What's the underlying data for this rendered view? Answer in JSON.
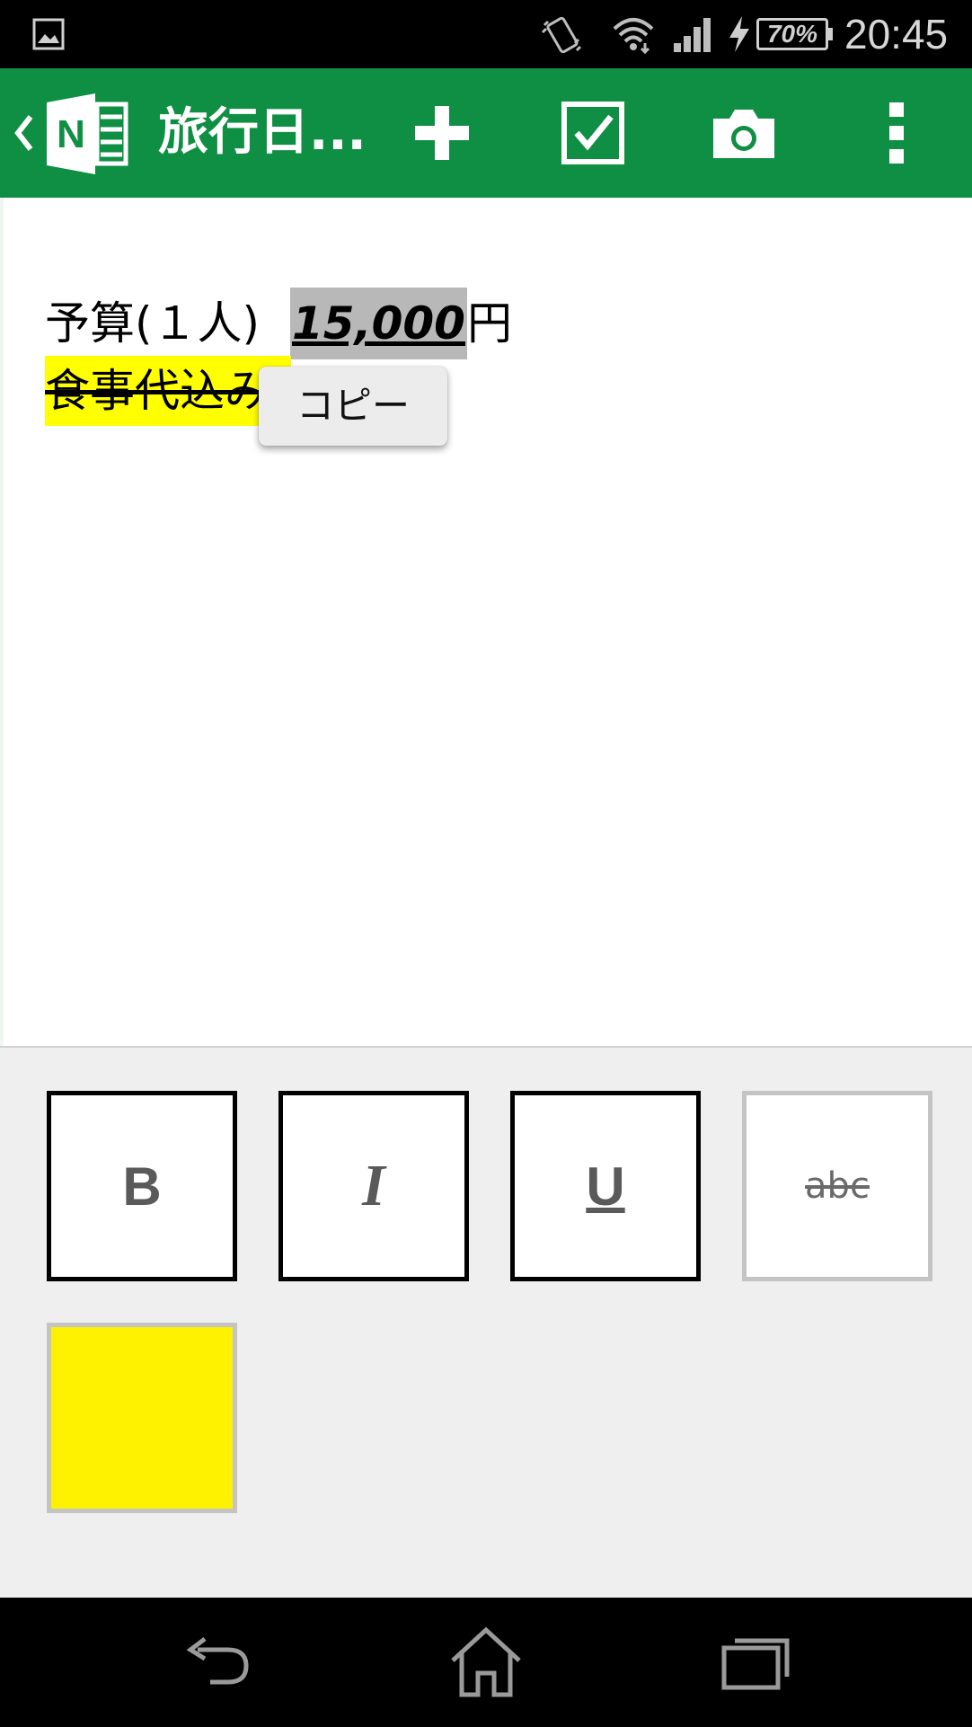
{
  "status_bar": {
    "battery": "70%",
    "time": "20:45",
    "icons": [
      "gallery-icon",
      "vibrate-icon",
      "wifi-icon",
      "signal-icon",
      "charging-icon",
      "battery-icon"
    ]
  },
  "app_bar": {
    "title": "旅行日...",
    "color": "#0f8f43",
    "icons": [
      "up-chevron-icon",
      "onenote-logo",
      "add-icon",
      "checkbox-icon",
      "camera-icon",
      "more-vert-icon"
    ]
  },
  "note": {
    "budget_label": "予算(１人)",
    "budget_value": "15,000",
    "budget_unit": "円",
    "meal_text": "食事代込み",
    "highlight_color": "#ffff00",
    "selection_color": "#b8b8b8"
  },
  "context_menu": {
    "copy_label": "コピー"
  },
  "format_panel": {
    "bold_label": "B",
    "italic_label": "I",
    "underline_label": "U",
    "strike_label": "abc",
    "highlight_color": "#fff200"
  },
  "nav_bar": {
    "icons": [
      "back-icon",
      "home-icon",
      "recent-apps-icon"
    ]
  }
}
